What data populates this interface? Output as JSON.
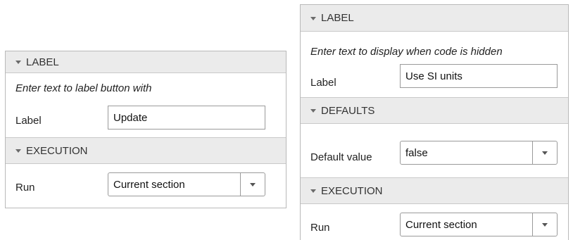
{
  "left_panel": {
    "label_section": {
      "title": "LABEL",
      "hint": "Enter text to label button with",
      "label_field": {
        "label": "Label",
        "value": "Update"
      }
    },
    "execution_section": {
      "title": "EXECUTION",
      "run_field": {
        "label": "Run",
        "value": "Current section"
      }
    }
  },
  "right_panel": {
    "label_section": {
      "title": "LABEL",
      "hint": "Enter text to display when code is hidden",
      "label_field": {
        "label": "Label",
        "value": "Use SI units"
      }
    },
    "defaults_section": {
      "title": "DEFAULTS",
      "default_field": {
        "label": "Default value",
        "value": "false"
      }
    },
    "execution_section": {
      "title": "EXECUTION",
      "run_field": {
        "label": "Run",
        "value": "Current section"
      }
    }
  },
  "icons": {
    "section_toggle": "triangle-down-icon",
    "dropdown_arrow": "chevron-down-icon"
  }
}
